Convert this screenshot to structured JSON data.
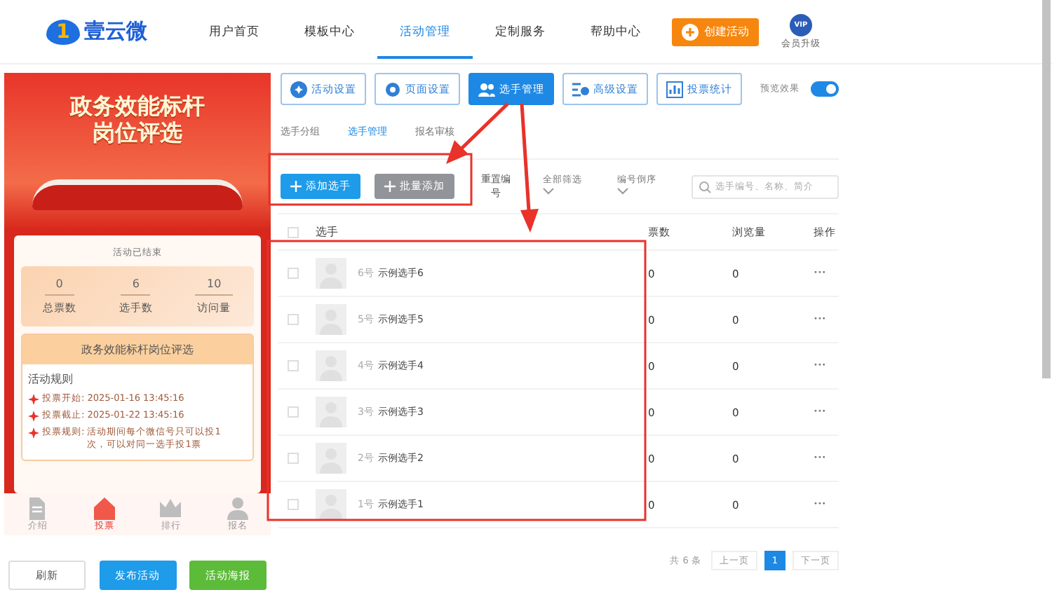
{
  "header": {
    "logo_mark": "1",
    "logo_text": "壹云微",
    "nav": [
      {
        "label": "用户首页",
        "selected": false
      },
      {
        "label": "模板中心",
        "selected": false
      },
      {
        "label": "活动管理",
        "selected": true
      },
      {
        "label": "定制服务",
        "selected": false
      },
      {
        "label": "帮助中心",
        "selected": false
      }
    ],
    "create_button": "创建活动",
    "vip_badge": "VIP",
    "vip_label": "会员升级"
  },
  "preview": {
    "banner_title": "政务效能标杆岗位评选",
    "status": "活动已结束",
    "stats": [
      {
        "value": "0",
        "label": "总票数"
      },
      {
        "value": "6",
        "label": "选手数"
      },
      {
        "value": "10",
        "label": "访问量"
      }
    ],
    "card_title": "政务效能标杆岗位评选",
    "rules_title": "活动规则",
    "rules": [
      {
        "label": "投票开始:",
        "text": "2025-01-16 13:45:16"
      },
      {
        "label": "投票截止:",
        "text": "2025-01-22 13:45:16"
      },
      {
        "label": "投票规则:",
        "text": "活动期间每个微信号只可以投1次，可以对同一选手投1票"
      }
    ],
    "bottom_nav": [
      {
        "label": "介绍",
        "kind": "doc",
        "selected": false
      },
      {
        "label": "投票",
        "kind": "home",
        "selected": true
      },
      {
        "label": "排行",
        "kind": "crown",
        "selected": false
      },
      {
        "label": "报名",
        "kind": "person",
        "selected": false
      }
    ]
  },
  "left_buttons": [
    {
      "label": "刷新",
      "kind": "plain"
    },
    {
      "label": "发布活动",
      "kind": "blue"
    },
    {
      "label": "活动海报",
      "kind": "green"
    }
  ],
  "toolbar": [
    {
      "label": "活动设置",
      "kind": "gear",
      "selected": false
    },
    {
      "label": "页面设置",
      "kind": "cog",
      "selected": false
    },
    {
      "label": "选手管理",
      "kind": "people",
      "selected": true
    },
    {
      "label": "高级设置",
      "kind": "sliders",
      "selected": false
    },
    {
      "label": "投票统计",
      "kind": "chart",
      "selected": false
    }
  ],
  "preview_toggle": {
    "label": "预览效果",
    "on": true
  },
  "sub_tabs": [
    {
      "label": "选手分组",
      "selected": false
    },
    {
      "label": "选手管理",
      "selected": true
    },
    {
      "label": "报名审核",
      "selected": false
    }
  ],
  "actions": {
    "add": "添加选手",
    "batch_add": "批量添加",
    "renumber": "重置编号",
    "filter": "全部筛选",
    "sort": "编号倒序",
    "search_placeholder": "选手编号、名称、简介"
  },
  "table": {
    "select_all_checked": false,
    "columns": [
      "选手",
      "票数",
      "浏览量",
      "操作"
    ],
    "rows": [
      {
        "checked": false,
        "number": "6号",
        "name": "示例选手6",
        "votes": "0",
        "views": "0",
        "more": "•••"
      },
      {
        "checked": false,
        "number": "5号",
        "name": "示例选手5",
        "votes": "0",
        "views": "0",
        "more": "•••"
      },
      {
        "checked": false,
        "number": "4号",
        "name": "示例选手4",
        "votes": "0",
        "views": "0",
        "more": "•••"
      },
      {
        "checked": false,
        "number": "3号",
        "name": "示例选手3",
        "votes": "0",
        "views": "0",
        "more": "•••"
      },
      {
        "checked": false,
        "number": "2号",
        "name": "示例选手2",
        "votes": "0",
        "views": "0",
        "more": "•••"
      },
      {
        "checked": false,
        "number": "1号",
        "name": "示例选手1",
        "votes": "0",
        "views": "0",
        "more": "•••"
      }
    ]
  },
  "pagination": {
    "total": "共 6 条",
    "prev": "上一页",
    "pages": [
      {
        "label": "1",
        "selected": true
      }
    ],
    "next": "下一页"
  }
}
